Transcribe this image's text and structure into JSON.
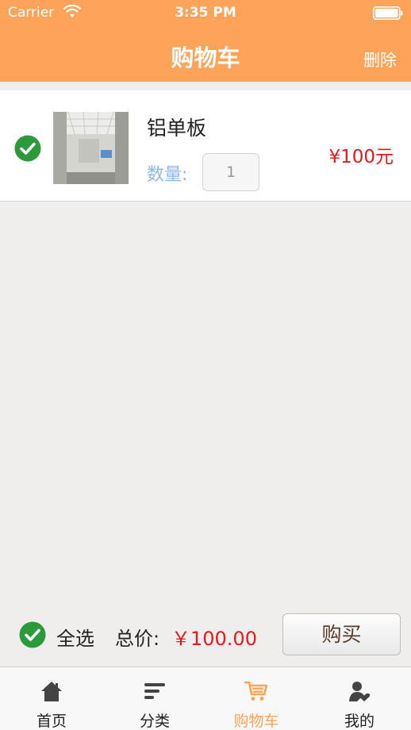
{
  "status_bar": {
    "carrier": "Carrier",
    "time": "3:35 PM"
  },
  "nav": {
    "title": "购物车",
    "delete_label": "删除"
  },
  "cart_item": {
    "name": "铝单板",
    "quantity_label": "数量:",
    "quantity": "1",
    "price": "¥100元",
    "checked": true
  },
  "footer": {
    "select_all_label": "全选",
    "total_label": "总价:",
    "total_value": "￥100.00",
    "buy_label": "购买"
  },
  "tabs": [
    {
      "label": "首页",
      "icon": "home-icon"
    },
    {
      "label": "分类",
      "icon": "category-icon"
    },
    {
      "label": "购物车",
      "icon": "cart-icon",
      "active": true
    },
    {
      "label": "我的",
      "icon": "profile-icon"
    }
  ],
  "colors": {
    "accent": "#fda45a",
    "check_green": "#2c9a3b",
    "price_red": "#e5191d",
    "qty_label_blue": "#8db9e4",
    "background": "#efeeec"
  }
}
